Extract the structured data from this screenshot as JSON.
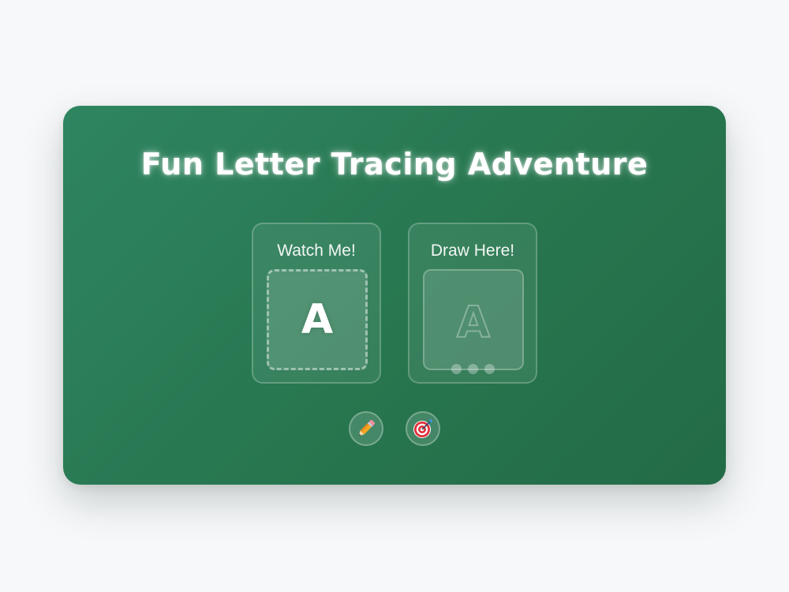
{
  "title": "Fun Letter Tracing Adventure",
  "panels": {
    "watch": {
      "label": "Watch Me!",
      "letter": "A"
    },
    "draw": {
      "label": "Draw Here!",
      "letter": "A"
    }
  },
  "tools": [
    {
      "icon": "pencil-icon"
    },
    {
      "icon": "target-icon"
    }
  ],
  "colors": {
    "board": "#2a7d57",
    "background": "#f7f8fa"
  }
}
